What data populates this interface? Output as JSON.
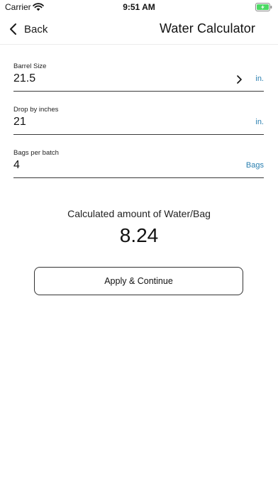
{
  "status_bar": {
    "carrier": "Carrier",
    "time": "9:51 AM",
    "wifi_icon": "wifi-icon",
    "battery_icon": "battery-charging-icon",
    "battery_color": "#4cd964"
  },
  "nav": {
    "back_label": "Back",
    "title": "Water Calculator",
    "back_icon": "chevron-left-icon"
  },
  "fields": [
    {
      "label": "Barrel Size",
      "value": "21.5",
      "unit": "in.",
      "has_chevron": true
    },
    {
      "label": "Drop by inches",
      "value": "21",
      "unit": "in.",
      "has_chevron": false
    },
    {
      "label": "Bags per batch",
      "value": "4",
      "unit": "Bags",
      "has_chevron": false
    }
  ],
  "result": {
    "label": "Calculated amount of Water/Bag",
    "value": "8.24"
  },
  "actions": {
    "apply_label": "Apply & Continue"
  },
  "colors": {
    "accent": "#2a7fb0"
  }
}
